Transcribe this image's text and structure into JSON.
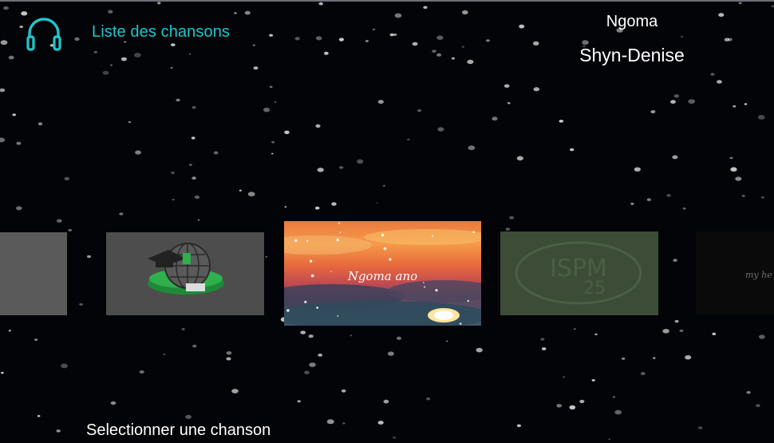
{
  "header": {
    "icon": "headphones-icon",
    "list_label": "Liste des chansons",
    "app_title": "Ngoma",
    "artist": "Shyn-Denise"
  },
  "carousel": {
    "main_title": "Ngoma ano",
    "right_title": "my he"
  },
  "footer": {
    "hint": "Selectionner une chanson"
  },
  "colors": {
    "accent": "#1fc7cc",
    "background": "#030407"
  }
}
